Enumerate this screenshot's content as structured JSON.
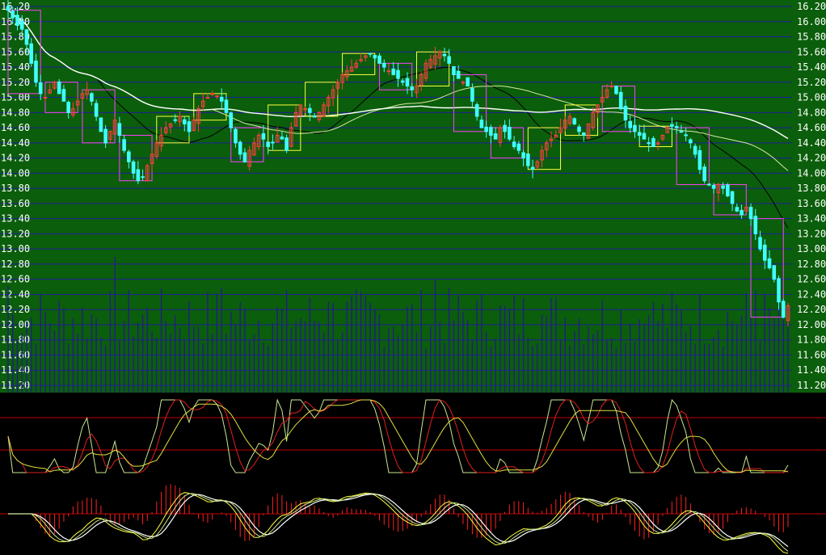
{
  "chart_data": [
    {
      "type": "candlestick",
      "panel": "price",
      "background": "#0b5e0b",
      "ylim": [
        11.2,
        16.2
      ],
      "y_ticks": [
        "16.20",
        "16.00",
        "15.80",
        "15.60",
        "15.40",
        "15.20",
        "15.00",
        "14.80",
        "14.60",
        "14.40",
        "14.20",
        "14.00",
        "13.80",
        "13.60",
        "13.40",
        "13.20",
        "13.00",
        "12.80",
        "12.60",
        "12.40",
        "12.20",
        "12.00",
        "11.80",
        "11.60",
        "11.40",
        "11.20"
      ],
      "grid": true,
      "colors": {
        "grid": "#1f1f9a",
        "candle_up": "#ff4040",
        "candle_down": "#40ffff",
        "ma_short": "#000000",
        "ma_mid": "#d8e8a0",
        "ma_long": "#ffffff",
        "box_up": "#ffff40",
        "box_down": "#ff40ff",
        "volume": "#202080"
      },
      "close": [
        16.15,
        16.05,
        15.95,
        15.9,
        15.7,
        15.45,
        15.2,
        15.05,
        15.0,
        15.1,
        15.2,
        15.05,
        14.95,
        14.8,
        14.85,
        14.95,
        15.05,
        15.1,
        14.95,
        14.75,
        14.55,
        14.4,
        14.55,
        14.7,
        14.5,
        14.3,
        14.15,
        14.0,
        13.9,
        13.95,
        14.1,
        14.25,
        14.4,
        14.5,
        14.6,
        14.65,
        14.7,
        14.75,
        14.65,
        14.55,
        14.7,
        14.85,
        14.95,
        15.0,
        15.05,
        15.02,
        14.95,
        14.8,
        14.6,
        14.4,
        14.25,
        14.15,
        14.3,
        14.4,
        14.5,
        14.45,
        14.35,
        14.4,
        14.5,
        14.45,
        14.3,
        14.6,
        14.8,
        14.9,
        14.85,
        14.8,
        14.75,
        14.8,
        14.9,
        15.0,
        15.1,
        15.2,
        15.3,
        15.35,
        15.4,
        15.45,
        15.5,
        15.55,
        15.58,
        15.52,
        15.45,
        15.4,
        15.35,
        15.3,
        15.25,
        15.2,
        15.15,
        15.1,
        15.15,
        15.3,
        15.45,
        15.5,
        15.55,
        15.6,
        15.55,
        15.45,
        15.3,
        15.25,
        15.2,
        15.15,
        14.95,
        14.75,
        14.6,
        14.55,
        14.5,
        14.45,
        14.6,
        14.55,
        14.45,
        14.35,
        14.3,
        14.2,
        14.1,
        14.05,
        14.15,
        14.3,
        14.4,
        14.45,
        14.5,
        14.6,
        14.7,
        14.75,
        14.65,
        14.55,
        14.5,
        14.65,
        14.8,
        14.9,
        15.0,
        15.1,
        15.15,
        15.05,
        14.85,
        14.7,
        14.6,
        14.55,
        14.5,
        14.45,
        14.4,
        14.35,
        14.4,
        14.5,
        14.6,
        14.62,
        14.6,
        14.55,
        14.5,
        14.4,
        14.25,
        14.05,
        13.9,
        13.85,
        13.8,
        13.85,
        13.8,
        13.7,
        13.6,
        13.5,
        13.45,
        13.55,
        13.4,
        13.2,
        13.0,
        12.85,
        12.75,
        12.6,
        12.3,
        12.1,
        12.25
      ]
    },
    {
      "type": "line",
      "panel": "oscillator",
      "background": "#000000",
      "grid": false,
      "guide_lines": 2,
      "colors": {
        "guide": "#c00000",
        "line_a": "#e0e040",
        "line_b": "#e02020",
        "line_c": "#c8e890"
      }
    },
    {
      "type": "line",
      "panel": "macd",
      "background": "#000000",
      "grid": false,
      "colors": {
        "zero": "#c00000",
        "hist": "#ff2020",
        "line_a": "#ffffff",
        "line_b": "#ffff40",
        "line_c": "#c8e890"
      }
    }
  ]
}
